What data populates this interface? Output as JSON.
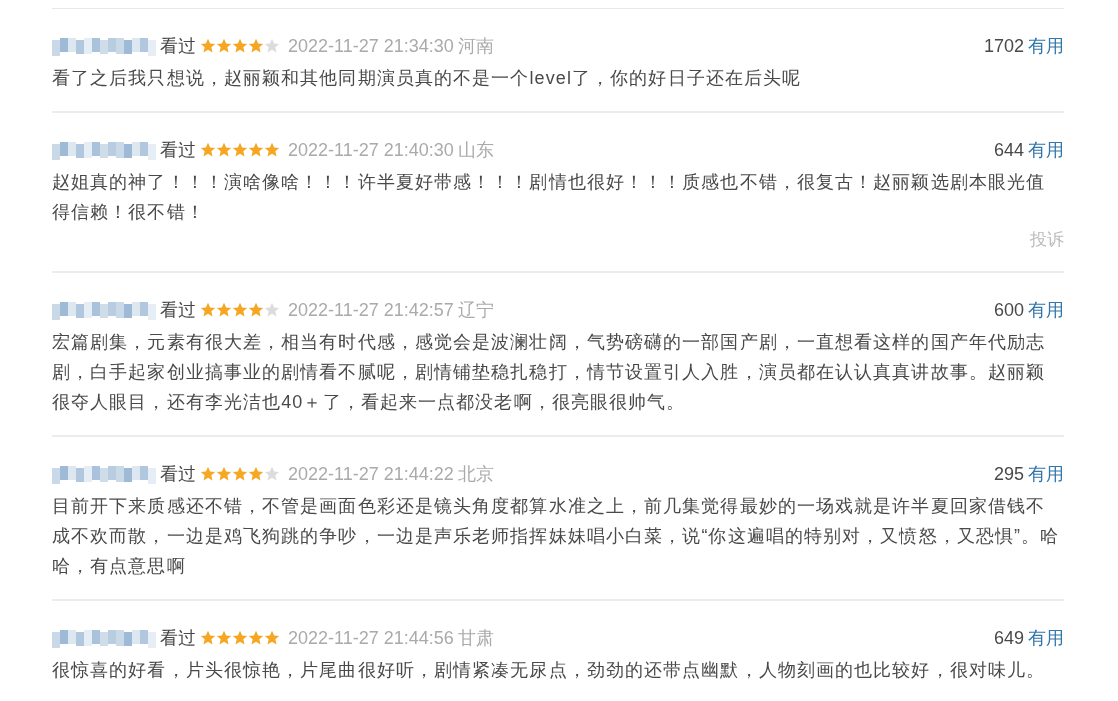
{
  "comments": [
    {
      "status": "看过",
      "stars": 4,
      "time": "2022-11-27 21:34:30",
      "region": "河南",
      "votes": "1702",
      "vote_label": "有用",
      "text": "看了之后我只想说，赵丽颖和其他同期演员真的不是一个level了，你的好日子还在后头呢"
    },
    {
      "status": "看过",
      "stars": 5,
      "time": "2022-11-27 21:40:30",
      "region": "山东",
      "votes": "644",
      "vote_label": "有用",
      "text": "赵姐真的神了！！！演啥像啥！！！许半夏好带感！！！剧情也很好！！！质感也不错，很复古！赵丽颖选剧本眼光值得信赖！很不错！",
      "report": "投诉"
    },
    {
      "status": "看过",
      "stars": 4,
      "time": "2022-11-27 21:42:57",
      "region": "辽宁",
      "votes": "600",
      "vote_label": "有用",
      "text": "宏篇剧集，元素有很大差，相当有时代感，感觉会是波澜壮阔，气势磅礴的一部国产剧，一直想看这样的国产年代励志剧，白手起家创业搞事业的剧情看不腻呢，剧情铺垫稳扎稳打，情节设置引人入胜，演员都在认认真真讲故事。赵丽颖很夺人眼目，还有李光洁也40＋了，看起来一点都没老啊，很亮眼很帅气。"
    },
    {
      "status": "看过",
      "stars": 4,
      "time": "2022-11-27 21:44:22",
      "region": "北京",
      "votes": "295",
      "vote_label": "有用",
      "text": "目前开下来质感还不错，不管是画面色彩还是镜头角度都算水准之上，前几集觉得最妙的一场戏就是许半夏回家借钱不成不欢而散，一边是鸡飞狗跳的争吵，一边是声乐老师指挥妹妹唱小白菜，说“你这遍唱的特别对，又愤怒，又恐惧”。哈哈，有点意思啊"
    },
    {
      "status": "看过",
      "stars": 5,
      "time": "2022-11-27 21:44:56",
      "region": "甘肃",
      "votes": "649",
      "vote_label": "有用",
      "text": "很惊喜的好看，片头很惊艳，片尾曲很好听，剧情紧凑无尿点，劲劲的还带点幽默，人物刻画的也比较好，很对味儿。"
    }
  ]
}
